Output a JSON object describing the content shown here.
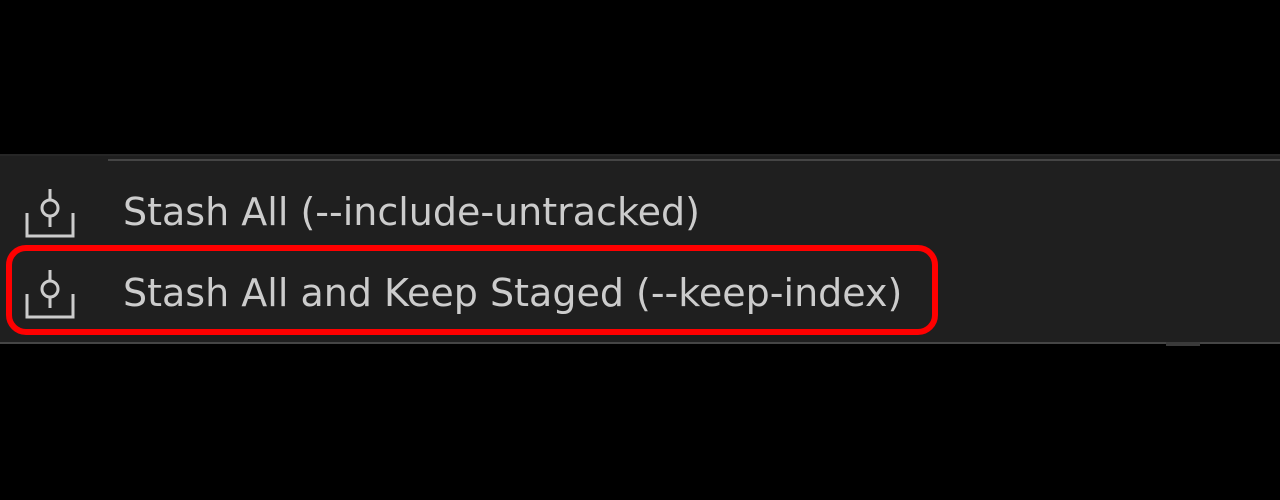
{
  "menu": {
    "items": [
      {
        "label": "Stash All (--include-untracked)",
        "icon": "stash-icon"
      },
      {
        "label": "Stash All and Keep Staged (--keep-index)",
        "icon": "stash-icon"
      }
    ],
    "highlighted_item": "Stash All and Keep Staged (--keep-index)"
  },
  "colors": {
    "background": "#000000",
    "menu_background": "#1f1f1f",
    "text": "#cccccc",
    "highlight": "#ff0000"
  }
}
